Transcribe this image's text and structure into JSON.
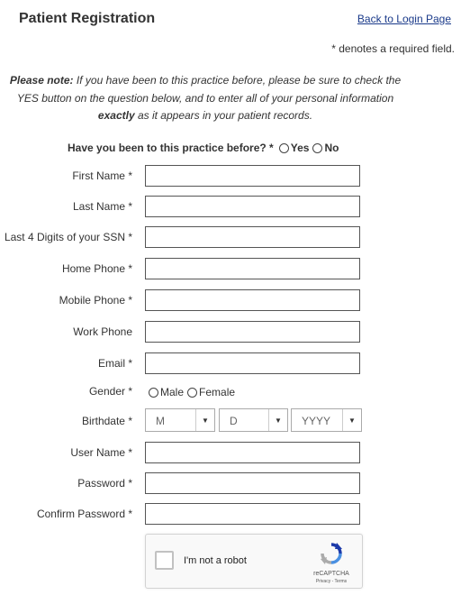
{
  "header": {
    "title": "Patient Registration",
    "back_link": "Back to Login Page",
    "required_note": "* denotes a required field."
  },
  "note": {
    "lead": "Please note:",
    "text_before": " If you have been to this practice before, please be sure to check the YES button on the question below, and to enter all of your personal information ",
    "emphasis": "exactly",
    "text_after": " as it appears in your patient records."
  },
  "question": {
    "label": "Have you been to this practice before? *",
    "yes": "Yes",
    "no": "No"
  },
  "fields": {
    "first_name": "First Name *",
    "last_name": "Last Name *",
    "ssn": "Last 4 Digits of your SSN *",
    "home_phone": "Home Phone *",
    "mobile_phone": "Mobile Phone *",
    "work_phone": "Work Phone",
    "email": "Email *",
    "gender": "Gender *",
    "birthdate": "Birthdate *",
    "username": "User Name *",
    "password": "Password *",
    "confirm_password": "Confirm Password *"
  },
  "gender": {
    "male": "Male",
    "female": "Female"
  },
  "birthdate": {
    "month": "M",
    "day": "D",
    "year": "YYYY"
  },
  "captcha": {
    "label": "I'm not a robot",
    "brand": "reCAPTCHA",
    "terms": "Privacy - Terms"
  },
  "colors": {
    "link": "#1a3a8a",
    "text": "#333333"
  }
}
